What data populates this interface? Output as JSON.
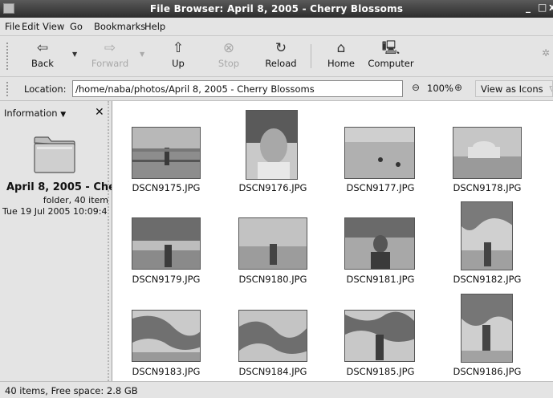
{
  "window": {
    "title": "File Browser: April 8, 2005 - Cherry Blossoms"
  },
  "menu": [
    "File",
    "Edit",
    "View",
    "Go",
    "Bookmarks",
    "Help"
  ],
  "toolbar": {
    "back": "Back",
    "forward": "Forward",
    "up": "Up",
    "stop": "Stop",
    "reload": "Reload",
    "home": "Home",
    "computer": "Computer"
  },
  "location": {
    "label": "Location:",
    "path": "/home/naba/photos/April 8, 2005 - Cherry Blossoms",
    "zoom": "100%",
    "view_as": "View as Icons"
  },
  "sidebar": {
    "selector": "Information",
    "folder_name": "April 8, 2005 - Che",
    "folder_info": "folder, 40 item",
    "modified": "Tue 19 Jul 2005 10:09:4"
  },
  "files": [
    "DSCN9175.JPG",
    "DSCN9176.JPG",
    "DSCN9177.JPG",
    "DSCN9178.JPG",
    "DSCN9179.JPG",
    "DSCN9180.JPG",
    "DSCN9181.JPG",
    "DSCN9182.JPG",
    "DSCN9183.JPG",
    "DSCN9184.JPG",
    "DSCN9185.JPG",
    "DSCN9186.JPG"
  ],
  "status": "40 items, Free space: 2.8 GB"
}
